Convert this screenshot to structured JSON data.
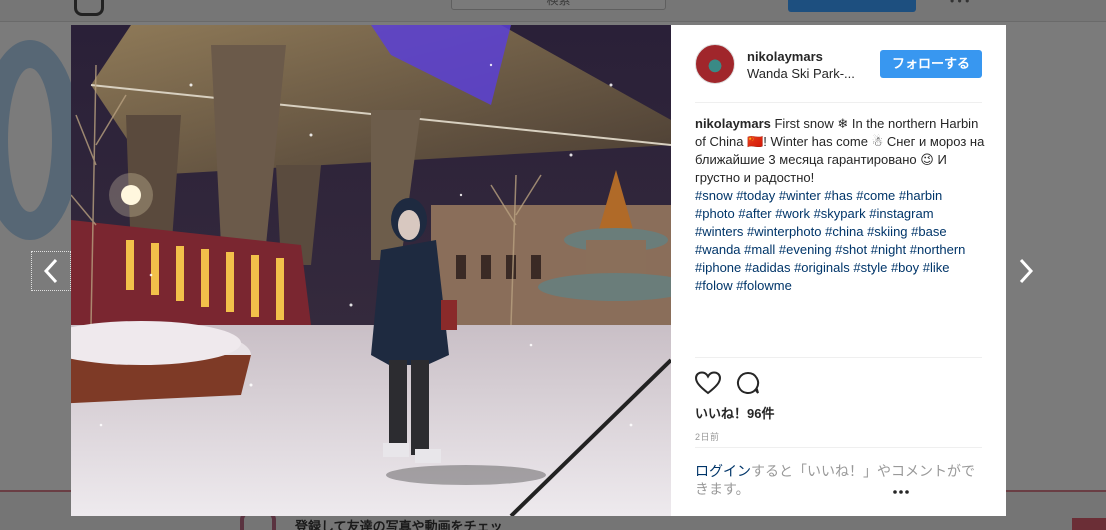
{
  "background": {
    "search_placeholder": "検索",
    "footer_text": "登録して友達の写真や動画をチェッ"
  },
  "post": {
    "username": "nikolaymars",
    "location": "Wanda Ski Park-...",
    "follow_label": "フォローする",
    "caption_user": "nikolaymars",
    "caption_text": " First snow ❄ In the northern Harbin of China 🇨🇳! Winter has come ☃ Снег и мороз на ближайшие 3 месяца гарантировано 😉 И грустно и радостно!",
    "hashtags": [
      "#snow",
      "#today",
      "#winter",
      "#has",
      "#come",
      "#harbin",
      "#photo",
      "#after",
      "#work",
      "#skypark",
      "#instagram",
      "#winters",
      "#winterphoto",
      "#china",
      "#skiing",
      "#base",
      "#wanda",
      "#mall",
      "#evening",
      "#shot",
      "#night",
      "#northern",
      "#iphone",
      "#adidas",
      "#originals",
      "#style",
      "#boy",
      "#like",
      "#folow",
      "#folowme"
    ],
    "likes_label": "いいね！96件",
    "time_label": "2日前",
    "login_link": "ログイン",
    "login_text": "すると「いいね！」やコメントができます。"
  },
  "icons": {
    "like": "heart-icon",
    "comment": "comment-icon",
    "prev": "chevron-left-icon",
    "next": "chevron-right-icon",
    "more": "more-options-icon"
  },
  "colors": {
    "follow_button": "#3897f0",
    "hashtag": "#003569"
  }
}
